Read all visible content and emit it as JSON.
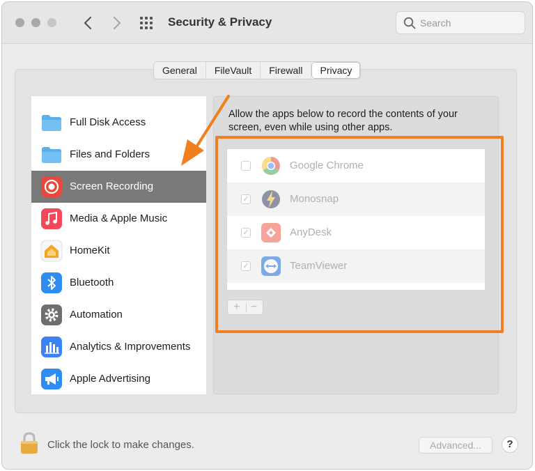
{
  "window": {
    "title": "Security & Privacy"
  },
  "search": {
    "placeholder": "Search"
  },
  "tabs": [
    {
      "label": "General",
      "active": false
    },
    {
      "label": "FileVault",
      "active": false
    },
    {
      "label": "Firewall",
      "active": false
    },
    {
      "label": "Privacy",
      "active": true
    }
  ],
  "sidebar": {
    "items": [
      {
        "label": "Full Disk Access",
        "icon": "folder-icon",
        "selected": false
      },
      {
        "label": "Files and Folders",
        "icon": "folder-icon",
        "selected": false
      },
      {
        "label": "Screen Recording",
        "icon": "screen-recording-icon",
        "selected": true
      },
      {
        "label": "Media & Apple Music",
        "icon": "music-icon",
        "selected": false
      },
      {
        "label": "HomeKit",
        "icon": "homekit-icon",
        "selected": false
      },
      {
        "label": "Bluetooth",
        "icon": "bluetooth-icon",
        "selected": false
      },
      {
        "label": "Automation",
        "icon": "gear-icon",
        "selected": false
      },
      {
        "label": "Analytics & Improvements",
        "icon": "analytics-icon",
        "selected": false
      },
      {
        "label": "Apple Advertising",
        "icon": "megaphone-icon",
        "selected": false
      }
    ]
  },
  "main": {
    "description": "Allow the apps below to record the contents of your screen, even while using other apps.",
    "apps": [
      {
        "name": "Google Chrome",
        "checked": false,
        "icon": "chrome-icon"
      },
      {
        "name": "Monosnap",
        "checked": true,
        "icon": "monosnap-icon"
      },
      {
        "name": "AnyDesk",
        "checked": true,
        "icon": "anydesk-icon"
      },
      {
        "name": "TeamViewer",
        "checked": true,
        "icon": "teamviewer-icon"
      }
    ],
    "add_label": "+",
    "remove_label": "−"
  },
  "footer": {
    "lock_text": "Click the lock to make changes.",
    "advanced_label": "Advanced...",
    "help_label": "?"
  },
  "colors": {
    "highlight": "#f07f20",
    "selected_row": "#7a7a7a",
    "folder": "#5ab0ea"
  }
}
